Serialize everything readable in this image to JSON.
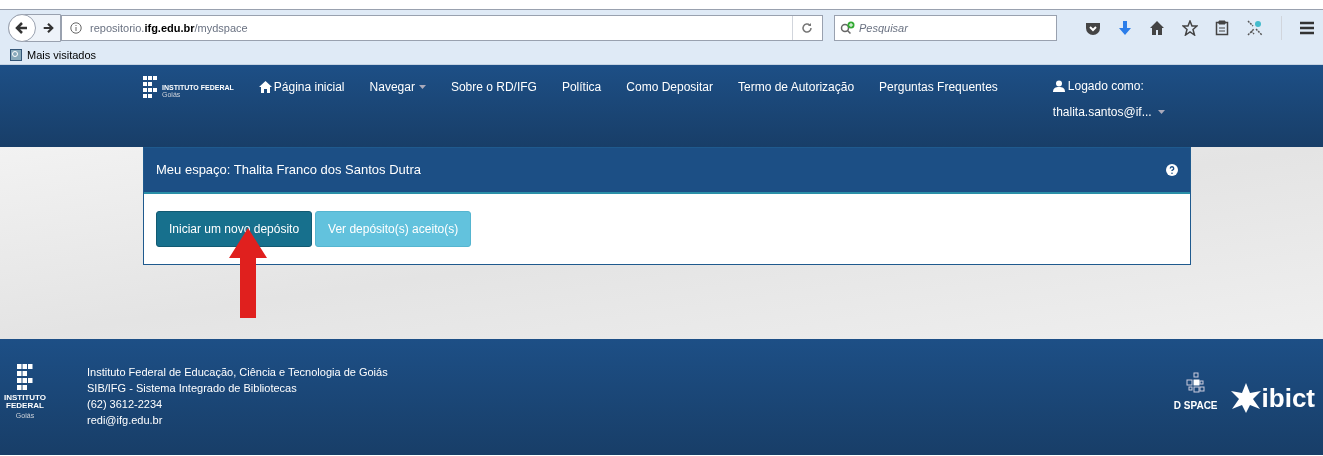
{
  "browser": {
    "url": "repositorio.**ifg.edu.br**/mydspace",
    "search_placeholder": "Pesquisar",
    "bookmark": "Mais visitados"
  },
  "navbar": {
    "logo": {
      "name": "INSTITUTO FEDERAL",
      "sub": "Goiás"
    },
    "items": [
      {
        "label": "Página inicial",
        "kind": "home"
      },
      {
        "label": "Navegar",
        "kind": "dropdown"
      },
      {
        "label": "Sobre o RD/IFG",
        "kind": "link"
      },
      {
        "label": "Política",
        "kind": "link"
      },
      {
        "label": "Como Depositar",
        "kind": "link"
      },
      {
        "label": "Termo de Autorização",
        "kind": "link"
      },
      {
        "label": "Perguntas Frequentes",
        "kind": "link"
      }
    ],
    "user": {
      "label": "Logado como:",
      "account": "thalita.santos@if..."
    }
  },
  "panel": {
    "title": "Meu espaço: Thalita Franco dos Santos Dutra",
    "buttons": [
      {
        "label": "Iniciar um novo depósito",
        "kind": "primary"
      },
      {
        "label": "Ver depósito(s) aceito(s)",
        "kind": "info"
      }
    ]
  },
  "footer": {
    "logo": {
      "line_1": "INSTITUTO",
      "line_2": "FEDERAL",
      "sub": "Goiás"
    },
    "lines": [
      "Instituto Federal de Educação, Ciência e Tecnologia de Goiás",
      "SIB/IFG - Sistema Integrado de Bibliotecas",
      "(62) 3612-2234",
      "redi@ifg.edu.br"
    ],
    "partners": {
      "dspace": "D SPACE",
      "ibict": "ibict"
    }
  }
}
